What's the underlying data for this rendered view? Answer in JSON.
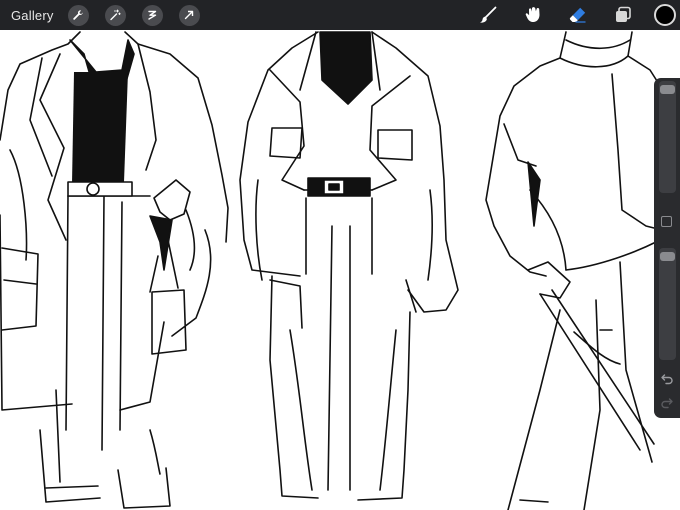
{
  "toolbar": {
    "gallery_label": "Gallery",
    "left_tools": [
      "wrench-icon",
      "magic-wand-icon",
      "selection-icon",
      "transform-arrow-icon"
    ],
    "right_tools": [
      "brush-icon",
      "smudge-icon",
      "eraser-icon",
      "layers-icon"
    ],
    "active_tool": "eraser-icon",
    "active_color": "#000000",
    "accent": "#2f7de1"
  },
  "sidebar": {
    "brush_size_level": 0.02,
    "opacity_level": 0.98,
    "buttons": [
      "modify-icon",
      "undo-icon",
      "redo-icon"
    ]
  }
}
